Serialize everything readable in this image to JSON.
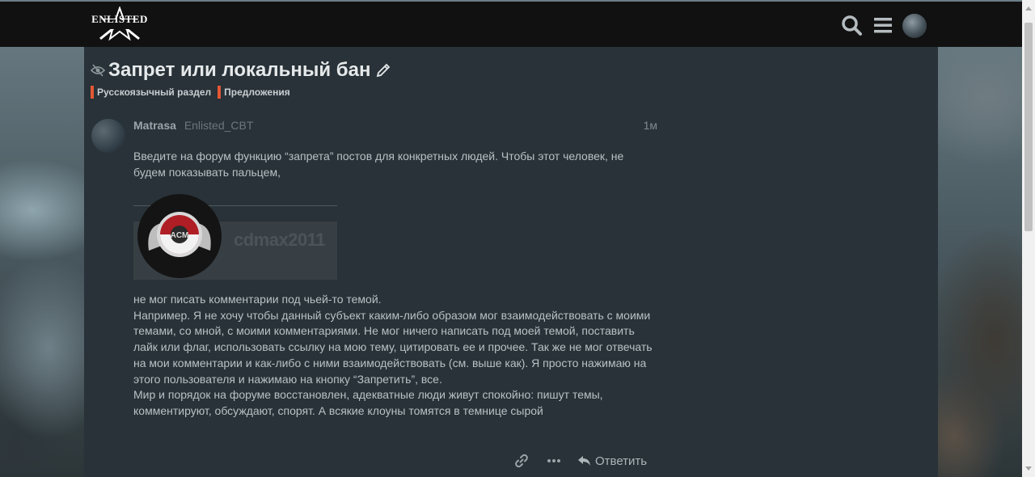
{
  "header": {
    "logo_text": "ENLISTED",
    "icons": [
      "search-icon",
      "menu-icon",
      "user-avatar"
    ]
  },
  "topic": {
    "title": "Запрет или локальный бан",
    "status_icon": "unlisted-icon",
    "edit_icon": "pencil-icon",
    "categories": [
      {
        "label": "Русскоязычный раздел",
        "color": "#e45735"
      },
      {
        "label": "Предложения",
        "color": "#e45735"
      }
    ]
  },
  "post": {
    "username": "Matrasa",
    "user_title": "Enlisted_CBT",
    "date": "1м",
    "paragraph1": "Введите на форум функцию “запрета” постов для конкретных людей. Чтобы этот человек, не будем показывать пальцем,",
    "quoted_user": "cdmax2011",
    "paragraph2_lines": [
      "не мог писать комментарии под чьей-то темой.",
      "Например. Я не хочу чтобы данный субъект каким-либо образом мог взаимодействовать с моими",
      "темами, со мной, с моими комментариями. Не мог ничего написать под моей темой, поставить",
      "лайк или флаг, использовать ссылку на мою тему, цитировать ее и прочее. Так же не мог отвечать",
      "на мои комментарии и как-либо с ними взаимодействовать (см. выше как). Я просто нажимаю на",
      "этого пользователя и нажимаю на кнопку “Запретить”, все.",
      "Мир и порядок на форуме восстановлен, адекватные люди живут спокойно: пишут темы,",
      "комментируют, обсуждают, спорят. А всякие клоуны томятся в темнице сырой"
    ]
  },
  "actions": {
    "reply_label": "Ответить",
    "icons": [
      "link-icon",
      "more-icon",
      "reply-icon"
    ]
  },
  "colors": {
    "header_bg": "#111111",
    "main_bg": "#283238",
    "category_accent": "#e45735"
  }
}
